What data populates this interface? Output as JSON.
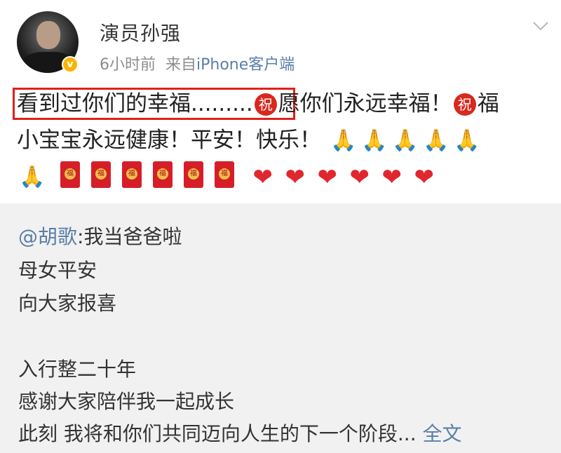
{
  "author": {
    "name": "演员孙强",
    "verified_badge": "v",
    "time": "6小时前",
    "source_prefix": "来自",
    "source": "iPhone客户端"
  },
  "post": {
    "line1_a": "看到过你们的幸福.........",
    "line1_b": "愿你们永远幸福！",
    "line1_c": "福",
    "line2": "小宝宝永远健康！平安！快乐！",
    "zhu_emoji": "祝",
    "envelope_char": "福",
    "emoji_counts": {
      "pray": 6,
      "red_envelope": 6,
      "heart": 6
    }
  },
  "repost": {
    "mention": "@胡歌",
    "line1": ":我当爸爸啦",
    "line2": "母女平安",
    "line3": "向大家报喜",
    "line4": "入行整二十年",
    "line5": "感谢大家陪伴我一起成长",
    "line6": "此刻 我将和你们共同迈向人生的下一个阶段...",
    "more": "全文"
  },
  "icons": {
    "menu": "chevron-down-icon",
    "pray": "folded-hands-icon",
    "envelope": "red-envelope-icon",
    "heart": "heart-icon",
    "zhu": "zhu-blessing-icon"
  },
  "colors": {
    "link": "#5a7ea8",
    "highlight_box": "#e0201b",
    "repost_bg": "#f1f1f1",
    "badge": "#f7b500"
  }
}
